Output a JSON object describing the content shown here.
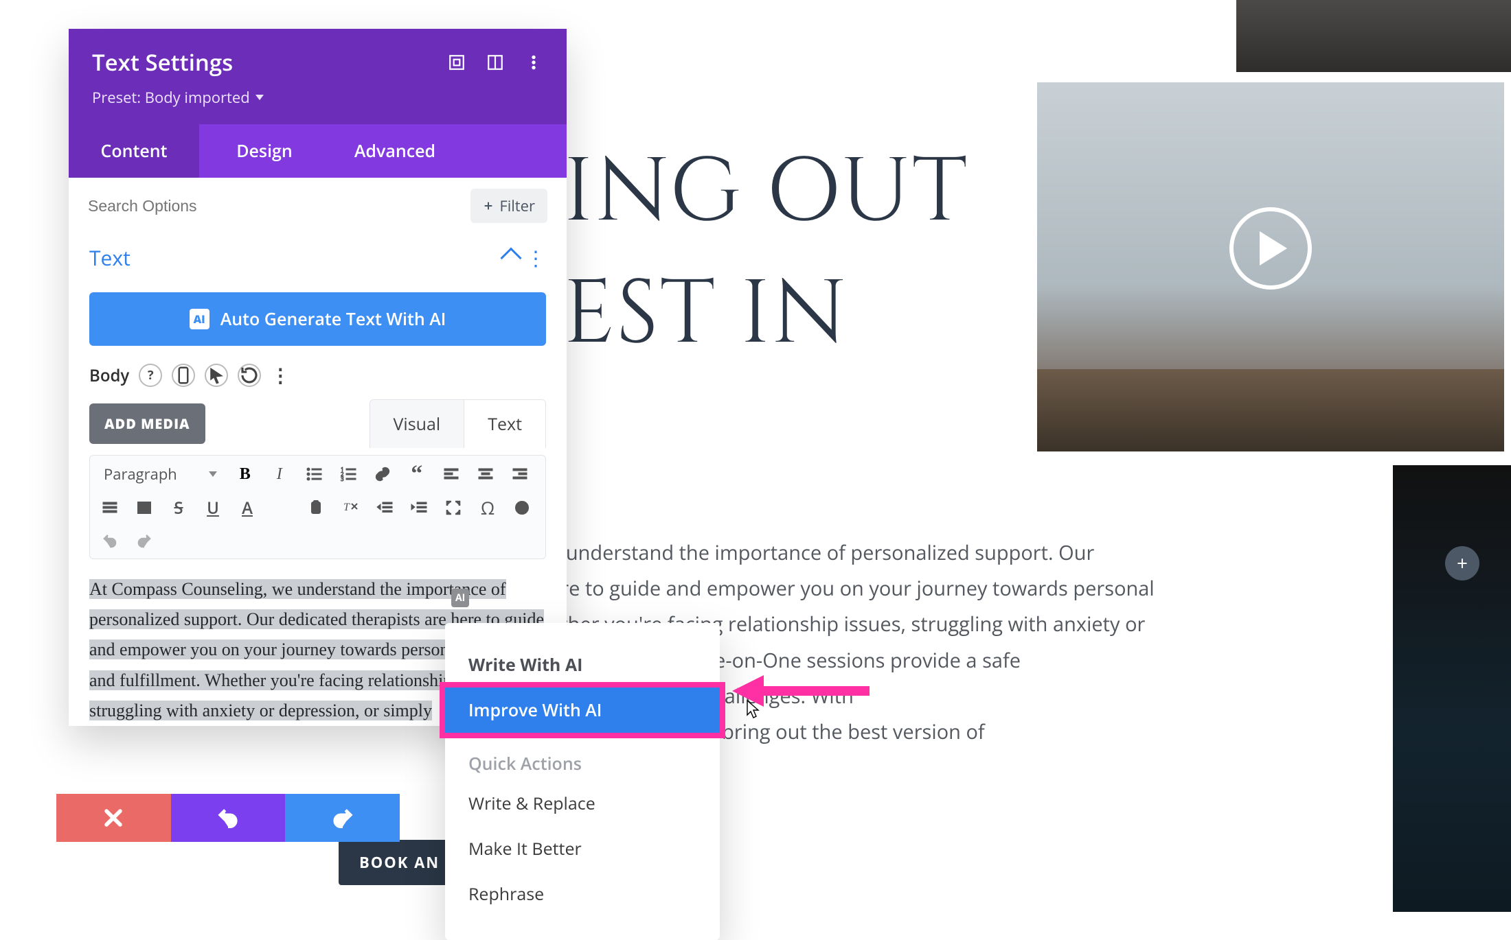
{
  "background": {
    "heading_line1": "ING OUT",
    "heading_line2": "EST IN",
    "paragraph": "e understand the importance of personalized support. Our\nere to guide and empower you on your journey towards personal\nether you're facing relationship issues, struggling with anxiety or\nelopment, our One-on-One sessions provide a safe\ngs, feelings, and challenges. With\ntrue potential and bring out the best version of\noday.",
    "book_button": "BOOK AN"
  },
  "panel": {
    "title": "Text Settings",
    "preset_label": "Preset: Body imported",
    "tabs": [
      "Content",
      "Design",
      "Advanced"
    ],
    "active_tab": 0,
    "search_placeholder": "Search Options",
    "filter_label": "Filter",
    "section_title": "Text",
    "ai_button": "Auto Generate Text With AI",
    "body_label": "Body",
    "add_media": "ADD MEDIA",
    "editor_tabs": [
      "Visual",
      "Text"
    ],
    "format_select": "Paragraph",
    "editor_text": "At Compass Counseling, we understand the importance of personalized support. Our dedicated therapists are here to guide and empower you on your journey towards personal growth and fulfillment. Whether you're facing relationship issues, struggling with anxiety or depression, or simply"
  },
  "context_menu": {
    "items": [
      {
        "label": "Write With AI",
        "type": "heading"
      },
      {
        "label": "Improve With AI",
        "type": "active"
      }
    ],
    "section_label": "Quick Actions",
    "quick_actions": [
      "Write & Replace",
      "Make It Better",
      "Rephrase"
    ]
  },
  "colors": {
    "primary_purple": "#6c2eb9",
    "secondary_purple": "#8239df",
    "blue": "#3e8ff4",
    "link_blue": "#2f80ed",
    "danger": "#ea6a67",
    "magenta": "#ff2fa4"
  }
}
